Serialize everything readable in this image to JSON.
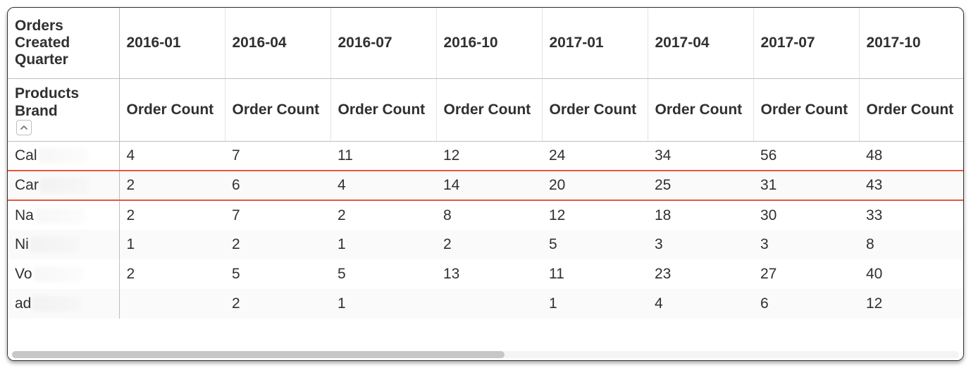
{
  "chart_data": {
    "type": "table",
    "title": "",
    "pivot_dimension": "Orders Created Quarter",
    "row_dimension": "Products Brand",
    "measure": "Order Count",
    "categories": [
      "2016-01",
      "2016-04",
      "2016-07",
      "2016-10",
      "2017-01",
      "2017-04",
      "2017-07",
      "2017-10"
    ],
    "series": [
      {
        "name": "Cal",
        "values": [
          4,
          7,
          11,
          12,
          24,
          34,
          56,
          48
        ]
      },
      {
        "name": "Car",
        "values": [
          2,
          6,
          4,
          14,
          20,
          25,
          31,
          43
        ],
        "highlighted": true
      },
      {
        "name": "Na",
        "values": [
          2,
          7,
          2,
          8,
          12,
          18,
          30,
          33
        ]
      },
      {
        "name": "Ni",
        "values": [
          1,
          2,
          1,
          2,
          5,
          3,
          3,
          8
        ]
      },
      {
        "name": "Vo",
        "values": [
          2,
          5,
          5,
          13,
          11,
          23,
          27,
          40
        ]
      },
      {
        "name": "ad",
        "values": [
          null,
          2,
          1,
          null,
          1,
          4,
          6,
          12
        ]
      }
    ]
  },
  "header1": {
    "rowdim_label": "Orders Created Quarter",
    "q0": "2016-01",
    "q1": "2016-04",
    "q2": "2016-07",
    "q3": "2016-10",
    "q4": "2017-01",
    "q5": "2017-04",
    "q6": "2017-07",
    "q7": "2017-10"
  },
  "header2": {
    "brand_label": "Products Brand",
    "metric": "Order Count"
  },
  "rows": {
    "0": {
      "brand": "Cal",
      "c0": "4",
      "c1": "7",
      "c2": "11",
      "c3": "12",
      "c4": "24",
      "c5": "34",
      "c6": "56",
      "c7": "48"
    },
    "1": {
      "brand": "Car",
      "c0": "2",
      "c1": "6",
      "c2": "4",
      "c3": "14",
      "c4": "20",
      "c5": "25",
      "c6": "31",
      "c7": "43"
    },
    "2": {
      "brand": "Na",
      "c0": "2",
      "c1": "7",
      "c2": "2",
      "c3": "8",
      "c4": "12",
      "c5": "18",
      "c6": "30",
      "c7": "33"
    },
    "3": {
      "brand": "Ni",
      "c0": "1",
      "c1": "2",
      "c2": "1",
      "c3": "2",
      "c4": "5",
      "c5": "3",
      "c6": "3",
      "c7": "8"
    },
    "4": {
      "brand": "Vo",
      "c0": "2",
      "c1": "5",
      "c2": "5",
      "c3": "13",
      "c4": "11",
      "c5": "23",
      "c6": "27",
      "c7": "40"
    },
    "5": {
      "brand": "ad",
      "c0": "",
      "c1": "2",
      "c2": "1",
      "c3": "",
      "c4": "1",
      "c5": "4",
      "c6": "6",
      "c7": "12"
    }
  }
}
